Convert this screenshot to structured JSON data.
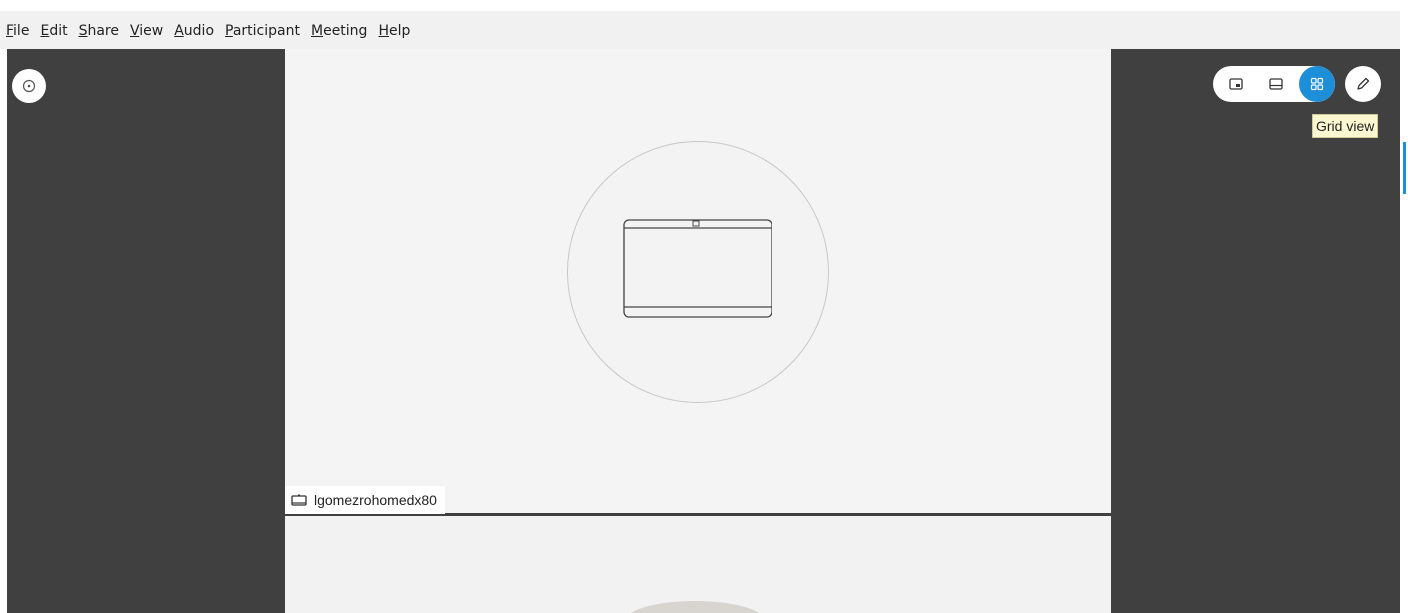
{
  "menu": {
    "items": [
      {
        "label": "File",
        "name": "menu-file"
      },
      {
        "label": "Edit",
        "name": "menu-edit"
      },
      {
        "label": "Share",
        "name": "menu-share"
      },
      {
        "label": "View",
        "name": "menu-view"
      },
      {
        "label": "Audio",
        "name": "menu-audio"
      },
      {
        "label": "Participant",
        "name": "menu-participant"
      },
      {
        "label": "Meeting",
        "name": "menu-meeting"
      },
      {
        "label": "Help",
        "name": "menu-help"
      }
    ]
  },
  "participants": [
    {
      "name": "lgomezrohomedx80",
      "icon": "video-device-icon"
    }
  ],
  "layout_controls": {
    "buttons": [
      {
        "name": "layout-picture-in-picture-button",
        "icon": "picture-in-picture-icon",
        "active": false
      },
      {
        "name": "layout-stack-button",
        "icon": "stack-view-icon",
        "active": false
      },
      {
        "name": "layout-grid-button",
        "icon": "grid-view-icon",
        "active": true
      }
    ],
    "tooltip": "Grid view",
    "accent_color": "#1d8fd8"
  },
  "icons": {
    "info": "info-icon",
    "pen": "pen-icon"
  }
}
